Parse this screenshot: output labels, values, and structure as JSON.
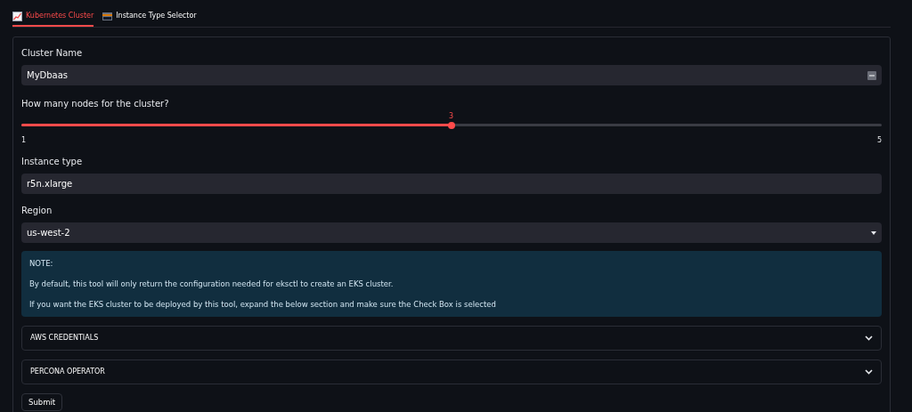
{
  "tabs": [
    {
      "label": "Kubernetes Cluster",
      "selected": true
    },
    {
      "label": "Instance Type Selector",
      "selected": false
    }
  ],
  "form": {
    "cluster_name": {
      "label": "Cluster Name",
      "value": "MyDbaas"
    },
    "nodes": {
      "label": "How many nodes for the cluster?",
      "reading": "3",
      "min": "1",
      "max": "5",
      "level": 0.5
    },
    "instance_type": {
      "label": "Instance type",
      "value": "r5n.xlarge"
    },
    "region": {
      "label": "Region",
      "value": "us-west-2"
    },
    "note": [
      "NOTE:",
      "By default, this tool will only return the configuration needed for eksctl to create an EKS cluster.",
      "If you want the EKS cluster to be deployed by this tool, expand the below section and make sure the Check Box is selected"
    ],
    "sections": [
      {
        "label": "AWS CREDENTIALS",
        "expanded": false
      },
      {
        "label": "PERCONA OPERATOR",
        "expanded": false
      }
    ],
    "submit": "Submit"
  }
}
